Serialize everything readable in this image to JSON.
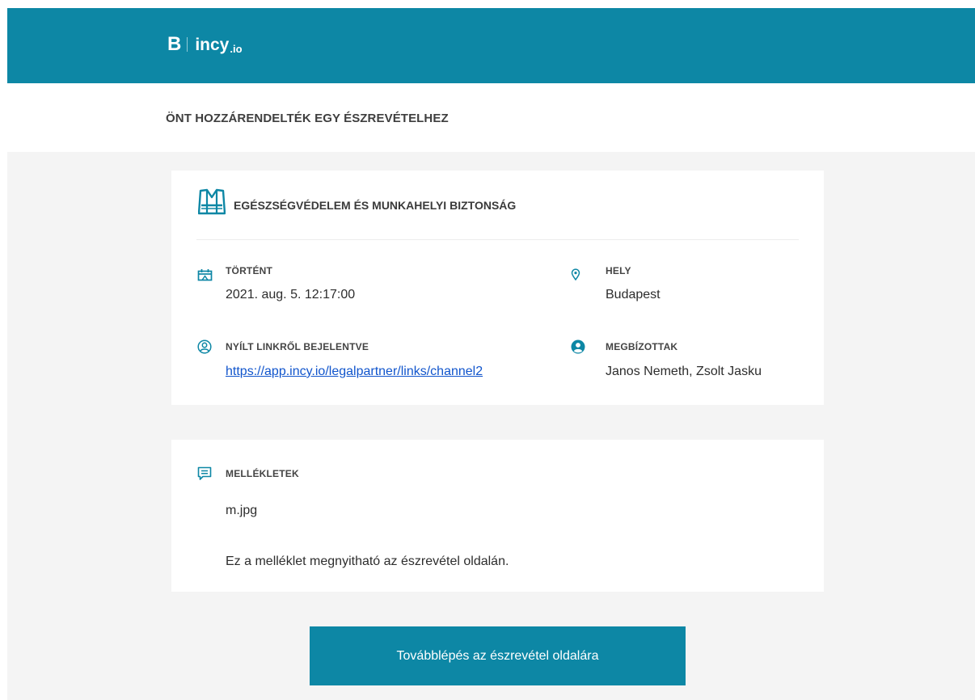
{
  "header": {
    "logo_mark": "B",
    "logo_name": "incy",
    "logo_suffix": ".io"
  },
  "notice_title": "ÖNT HOZZÁRENDELTÉK EGY ÉSZREVÉTELHEZ",
  "report": {
    "category_icon": "safety-vest-icon",
    "category": "EGÉSZSÉGVÉDELEM ÉS MUNKAHELYI BIZTONSÁG",
    "occurred": {
      "icon": "calendar-icon",
      "label": "TÖRTÉNT",
      "value": "2021. aug. 5. 12:17:00"
    },
    "location": {
      "icon": "location-pin-icon",
      "label": "HELY",
      "value": "Budapest"
    },
    "reported_via": {
      "icon": "user-outline-icon",
      "label": "NYÍLT LINKRŐL BEJELENTVE",
      "value": "https://app.incy.io/legalpartner/links/channel2"
    },
    "assignees": {
      "icon": "user-filled-icon",
      "label": "MEGBÍZOTTAK",
      "value": "Janos Nemeth, Zsolt Jasku"
    }
  },
  "attachments": {
    "icon": "message-icon",
    "label": "MELLÉKLETEK",
    "file": "m.jpg",
    "note": "Ez a melléklet megnyitható az észrevétel oldalán."
  },
  "cta_label": "Továbblépés az észrevétel oldalára",
  "colors": {
    "brand": "#0d87a5",
    "background": "#f4f4f4",
    "link": "#1155cc"
  }
}
